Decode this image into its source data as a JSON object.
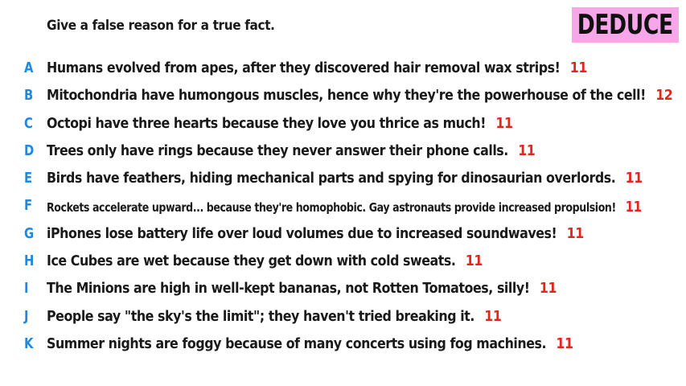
{
  "prompt": "Give a false reason for a true fact.",
  "badge": "DEDUCE",
  "colors": {
    "badge_bg": "#f7a6ea",
    "letter": "#1f88e0",
    "score": "#e0261f",
    "text": "#1a1a1a"
  },
  "answers": [
    {
      "letter": "A",
      "text": "Humans evolved from apes, after they discovered hair removal wax strips!",
      "score": "11"
    },
    {
      "letter": "B",
      "text": "Mitochondria have humongous muscles, hence why they're the powerhouse of the cell!",
      "score": "12"
    },
    {
      "letter": "C",
      "text": "Octopi have three hearts because they love you thrice as much!",
      "score": "11"
    },
    {
      "letter": "D",
      "text": "Trees only have rings because they never answer their phone calls.",
      "score": "11"
    },
    {
      "letter": "E",
      "text": "Birds have feathers, hiding mechanical parts and spying for dinosaurian overlords.",
      "score": "11"
    },
    {
      "letter": "F",
      "text": "Rockets accelerate upward... because they're homophobic. Gay astronauts provide increased propulsion!",
      "score": "11"
    },
    {
      "letter": "G",
      "text": "iPhones lose battery life over loud volumes due to increased soundwaves!",
      "score": "11"
    },
    {
      "letter": "H",
      "text": "Ice Cubes are wet because they get down with cold sweats.",
      "score": "11"
    },
    {
      "letter": "I",
      "text": "The Minions are high in well-kept bananas, not Rotten Tomatoes, silly!",
      "score": "11"
    },
    {
      "letter": "J",
      "text": "People say \"the sky's the limit\"; they haven't tried breaking it.",
      "score": "11"
    },
    {
      "letter": "K",
      "text": "Summer nights are foggy because of many concerts using fog machines.",
      "score": "11"
    }
  ]
}
